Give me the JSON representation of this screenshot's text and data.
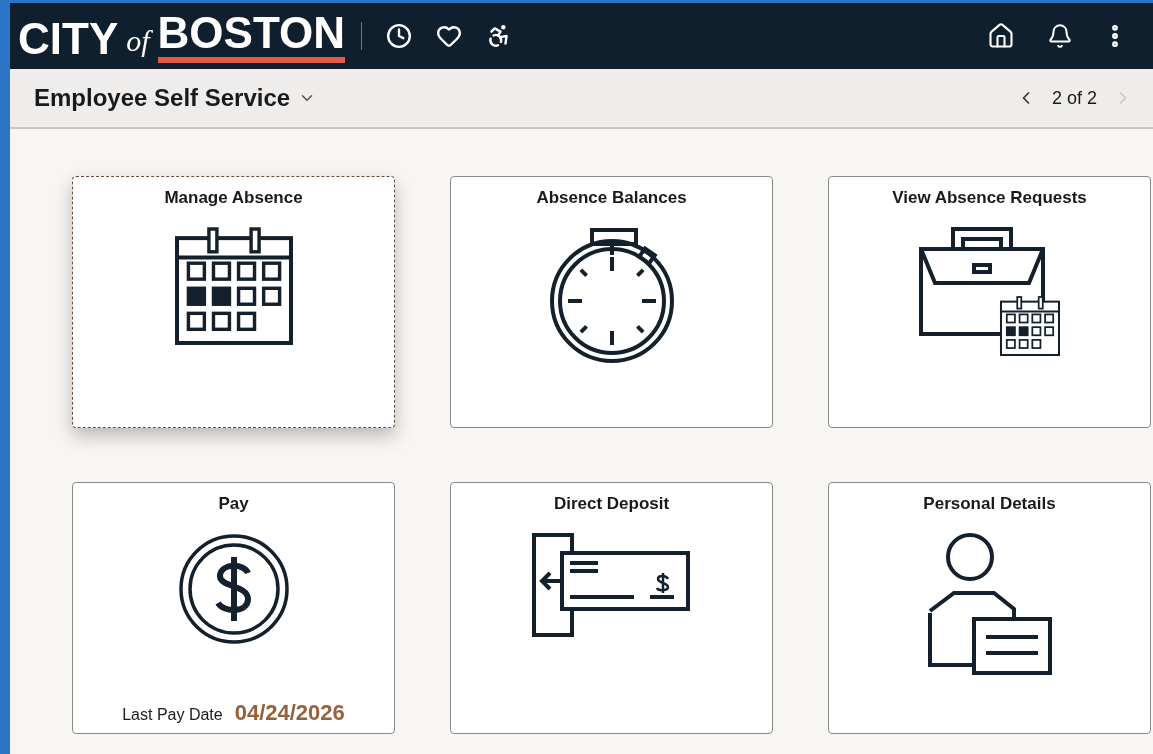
{
  "header": {
    "logo": {
      "first": "CITY",
      "middle": "of",
      "last": "BOSTON"
    }
  },
  "title_bar": {
    "title": "Employee Self Service",
    "pager": {
      "text": "2 of 2",
      "prev": {
        "disabled": false
      },
      "next": {
        "disabled": true
      }
    }
  },
  "tiles": [
    {
      "title": "Manage Absence",
      "kind": "calendar",
      "focused": true
    },
    {
      "title": "Absence Balances",
      "kind": "stopwatch",
      "focused": false
    },
    {
      "title": "View Absence Requests",
      "kind": "briefcase",
      "focused": false
    },
    {
      "title": "Pay",
      "kind": "coin",
      "focused": false,
      "footer": {
        "label": "Last Pay Date",
        "value": "04/24/2026"
      }
    },
    {
      "title": "Direct Deposit",
      "kind": "check",
      "focused": false
    },
    {
      "title": "Personal Details",
      "kind": "person",
      "focused": false
    }
  ]
}
